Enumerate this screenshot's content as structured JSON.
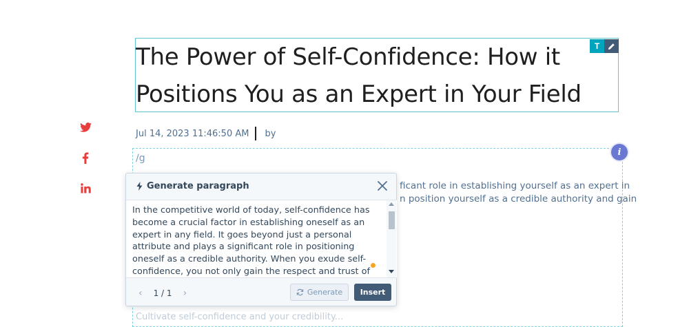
{
  "post": {
    "title_line1": "The Power of Self-Confidence: How it",
    "title_line2": "Positions You as an Expert in Your Field",
    "date": "Jul 14, 2023 11:46:50 AM",
    "by_label": "by",
    "slash_command": "/g",
    "background_line1": "ficant role in establishing yourself as an expert in",
    "background_line2": "n position yourself as a credible authority and gain",
    "background_bottom": "Cultivate self-confidence and your credibility..."
  },
  "title_tools": {
    "text_button": "T"
  },
  "share": {
    "items": [
      "twitter-icon",
      "facebook-icon",
      "linkedin-icon"
    ],
    "color": "#e83e3e"
  },
  "info_badge": {
    "label": "i"
  },
  "popup": {
    "title": "Generate paragraph",
    "generated_text": "In the competitive world of today, self-confidence has become a crucial factor in establishing oneself as an expert in any field. It goes beyond just a personal attribute and plays a significant role in positioning oneself as a credible authority. When you exude self-confidence, you not only gain the respect and trust of others, but you also become a",
    "pager": "1 / 1",
    "generate_label": "Generate",
    "insert_label": "Insert"
  },
  "colors": {
    "accent": "#00a4bd",
    "dark": "#425b76",
    "info": "#6a78d1"
  }
}
